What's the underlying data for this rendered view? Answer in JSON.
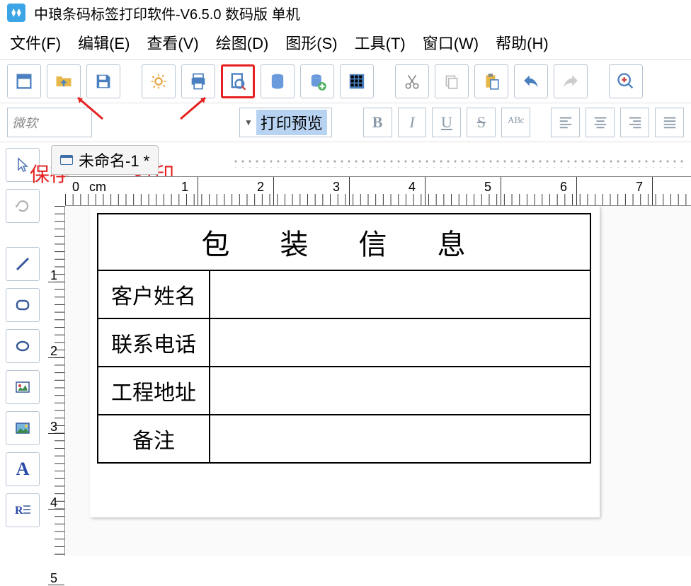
{
  "title": "中琅条码标签打印软件-V6.5.0 数码版 单机",
  "menu": {
    "file": "文件(F)",
    "edit": "编辑(E)",
    "view": "查看(V)",
    "draw": "绘图(D)",
    "shape": "图形(S)",
    "tool": "工具(T)",
    "window": "窗口(W)",
    "help": "帮助(H)"
  },
  "annotations": {
    "save": "保存",
    "print": "打印",
    "preview": "打印预览"
  },
  "font_placeholder": "微软",
  "doc_tab": "未命名-1 *",
  "ruler": {
    "zero": "0",
    "unit": "cm",
    "marks": [
      1,
      2,
      3,
      4,
      5,
      6,
      7
    ]
  },
  "label": {
    "title": "包 装 信 息",
    "rows": [
      "客户姓名",
      "联系电话",
      "工程地址",
      "备注"
    ]
  },
  "format_buttons": {
    "b": "B",
    "i": "I",
    "u": "U",
    "s": "S",
    "abc": "ᴬᴮᶜ"
  }
}
